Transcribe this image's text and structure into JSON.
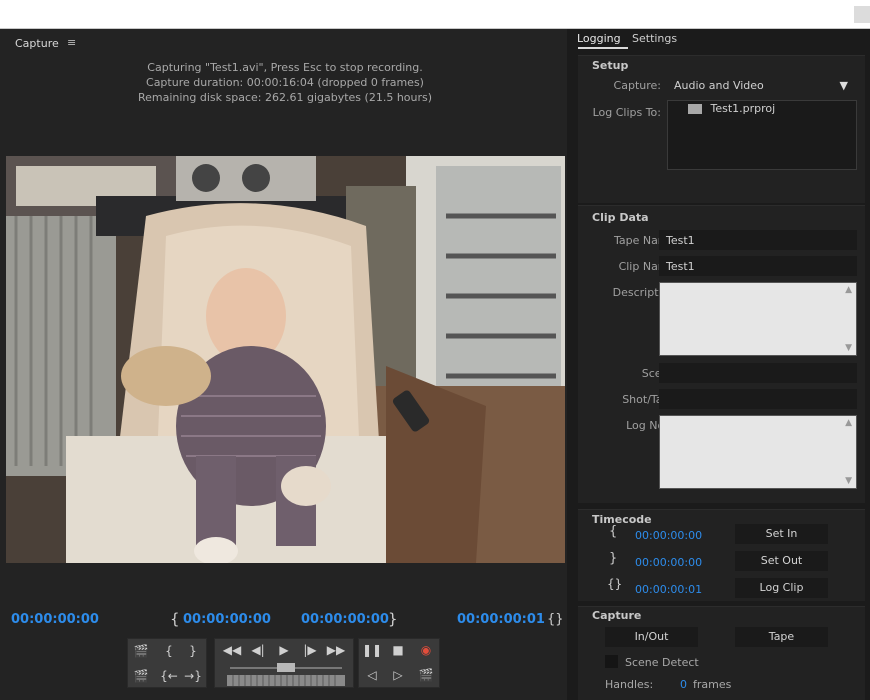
{
  "panel": {
    "title": "Capture",
    "menu_icon": "hamburger-icon"
  },
  "status": {
    "line1": "Capturing \"Test1.avi\", Press Esc to stop recording.",
    "line2": "Capture duration: 00:00:16:04  (dropped 0 frames)",
    "line3": "Remaining disk space: 262.61 gigabytes (21.5 hours)"
  },
  "timecodes": {
    "current": "00:00:00:00",
    "in_point": "00:00:00:00",
    "out_point": "00:00:00:00",
    "duration": "00:00:00:01"
  },
  "tabs": [
    "Logging",
    "Settings"
  ],
  "setup": {
    "title": "Setup",
    "capture_label": "Capture:",
    "capture_value": "Audio and Video",
    "log_clips_label": "Log Clips To:",
    "log_clips_value": "Test1.prproj"
  },
  "clip_data": {
    "title": "Clip Data",
    "tape_name_label": "Tape Name:",
    "tape_name_value": "Test1",
    "clip_name_label": "Clip Name:",
    "clip_name_value": "Test1",
    "description_label": "Description:",
    "scene_label": "Scene:",
    "shot_take_label": "Shot/Take:",
    "log_note_label": "Log Note:"
  },
  "timecode": {
    "title": "Timecode",
    "in_value": "00:00:00:00",
    "out_value": "00:00:00:00",
    "duration_value": "00:00:00:01",
    "set_in": "Set In",
    "set_out": "Set Out",
    "log_clip": "Log Clip"
  },
  "capture": {
    "title": "Capture",
    "in_out": "In/Out",
    "tape": "Tape",
    "scene_detect": "Scene Detect",
    "handles_label": "Handles:",
    "handles_value": "0",
    "handles_unit": "frames"
  }
}
